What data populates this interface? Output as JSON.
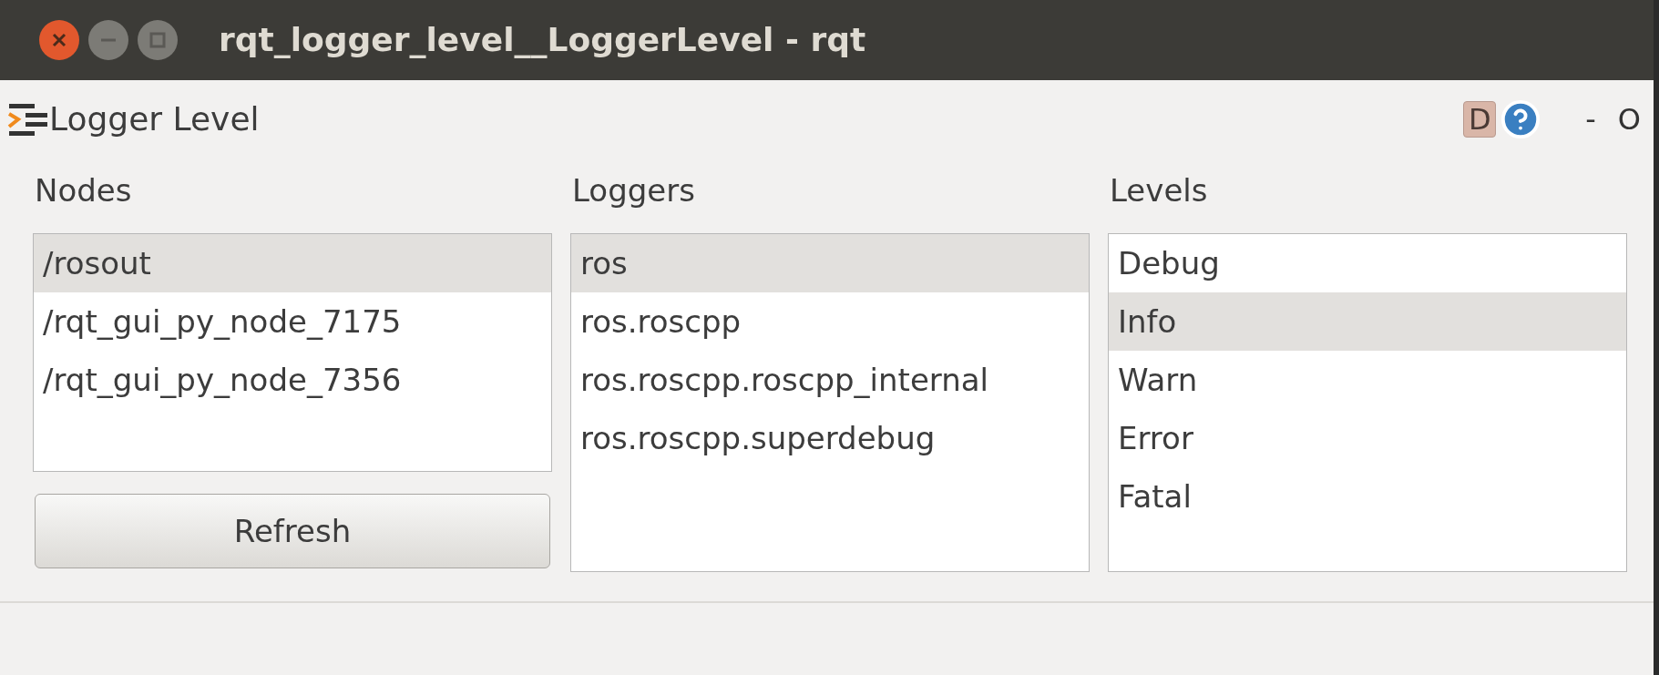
{
  "window": {
    "title": "rqt_logger_level__LoggerLevel - rqt"
  },
  "plugin": {
    "title": "Logger Level",
    "buttons": [
      "D",
      "-",
      "O"
    ]
  },
  "nodes": {
    "label": "Nodes",
    "items": [
      {
        "text": "/rosout",
        "selected": true
      },
      {
        "text": "/rqt_gui_py_node_7175",
        "selected": false
      },
      {
        "text": "/rqt_gui_py_node_7356",
        "selected": false
      }
    ],
    "refresh": "Refresh"
  },
  "loggers": {
    "label": "Loggers",
    "items": [
      {
        "text": "ros",
        "selected": true
      },
      {
        "text": "ros.roscpp",
        "selected": false
      },
      {
        "text": "ros.roscpp.roscpp_internal",
        "selected": false
      },
      {
        "text": "ros.roscpp.superdebug",
        "selected": false
      }
    ]
  },
  "levels": {
    "label": "Levels",
    "items": [
      {
        "text": "Debug",
        "selected": false
      },
      {
        "text": "Info",
        "selected": true
      },
      {
        "text": "Warn",
        "selected": false
      },
      {
        "text": "Error",
        "selected": false
      },
      {
        "text": "Fatal",
        "selected": false
      }
    ]
  }
}
